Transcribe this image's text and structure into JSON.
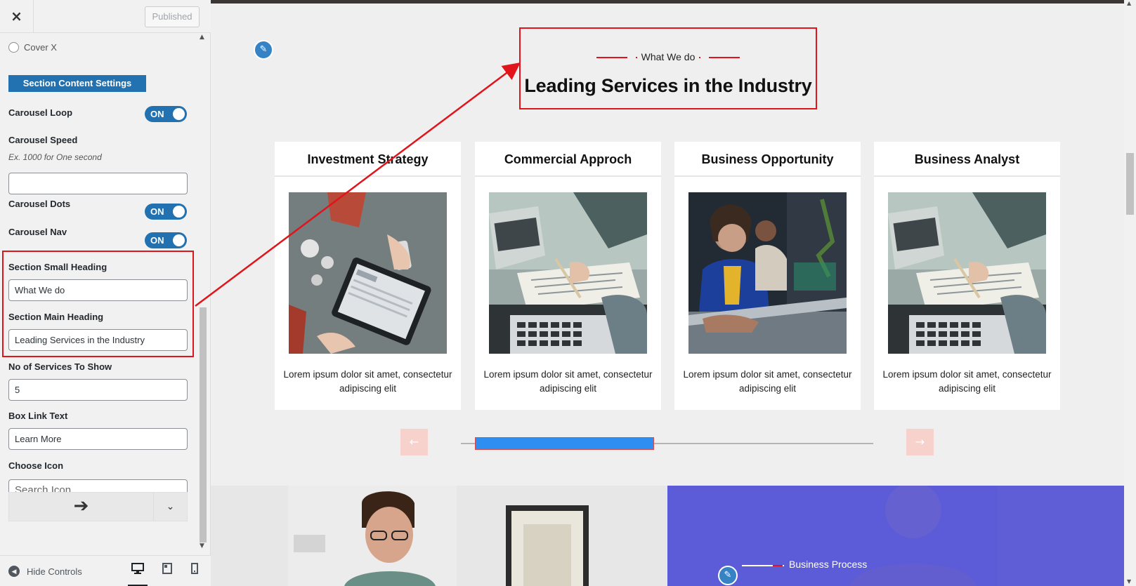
{
  "header": {
    "close_label": "×",
    "publish_label": "Published"
  },
  "sidebar": {
    "radio_option": "Cover X",
    "section_button": "Section Content Settings",
    "controls": {
      "carousel_loop": {
        "label": "Carousel Loop",
        "toggle": "ON"
      },
      "carousel_speed": {
        "label": "Carousel Speed",
        "description": "Ex. 1000 for One second",
        "value": ""
      },
      "carousel_dots": {
        "label": "Carousel Dots",
        "toggle": "ON"
      },
      "carousel_nav": {
        "label": "Carousel Nav",
        "toggle": "ON"
      },
      "small_heading": {
        "label": "Section Small Heading",
        "value": "What We do"
      },
      "main_heading": {
        "label": "Section Main Heading",
        "value": "Leading Services in the Industry"
      },
      "services_count": {
        "label": "No of Services To Show",
        "value": "5"
      },
      "box_link_text": {
        "label": "Box Link Text",
        "value": "Learn More"
      },
      "choose_icon": {
        "label": "Choose Icon",
        "placeholder": "Search Icon"
      }
    },
    "footer": {
      "hide_controls": "Hide Controls"
    }
  },
  "preview": {
    "small_heading": "What We do",
    "main_heading": "Leading Services in the Industry",
    "services": [
      {
        "title": "Investment Strategy",
        "text": "Lorem ipsum dolor sit amet, consectetur adipiscing elit"
      },
      {
        "title": "Commercial Approch",
        "text": "Lorem ipsum dolor sit amet, consectetur adipiscing elit"
      },
      {
        "title": "Business Opportunity",
        "text": "Lorem ipsum dolor sit amet, consectetur adipiscing elit"
      },
      {
        "title": "Business Analyst",
        "text": "Lorem ipsum dolor sit amet, consectetur adipiscing elit"
      }
    ],
    "carousel_progress": 0.45,
    "next_section_label": "Business Process"
  },
  "colors": {
    "accent": "#2271b1",
    "highlight": "#e0141a",
    "progress": "#2e8ef2",
    "purple": "#5b5bd6"
  }
}
